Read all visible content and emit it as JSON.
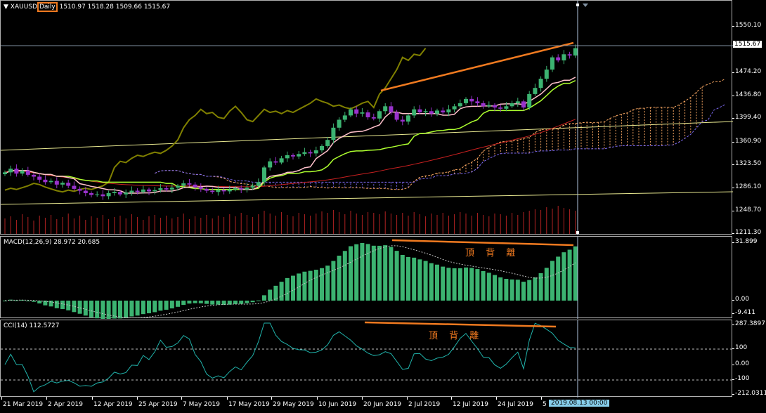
{
  "header": {
    "collapse_icon": "triangle-down-icon",
    "symbol": "XAUUSD",
    "timeframe": "Daily",
    "ohlc": "1510.97 1518.28 1509.66 1515.67"
  },
  "macd_label": "MACD(12,26,9) 28.972 20.685",
  "cci_label": "CCI(14) 112.5727",
  "annotation": "頂 背 離",
  "price_axis": [
    "1550.10",
    "1474.20",
    "1436.80",
    "1399.40",
    "1360.90",
    "1323.50",
    "1286.10",
    "1248.70",
    "1211.30"
  ],
  "current_price": "1515.67",
  "macd_axis": [
    "31.899",
    "0.00",
    "-9.411"
  ],
  "cci_axis": [
    "287.3897",
    "100",
    "0.00",
    "-100",
    "-212.0311"
  ],
  "time_axis": [
    "21 Mar 2019",
    "2 Apr 2019",
    "12 Apr 2019",
    "25 Apr 2019",
    "7 May 2019",
    "17 May 2019",
    "29 May 2019",
    "10 Jun 2019",
    "20 Jun 2019",
    "2 Jul 2019",
    "12 Jul 2019",
    "24 Jul 2019",
    "5"
  ],
  "crosshair_time": "2019.08.13 00:00",
  "colors": {
    "bull": "#3cb371",
    "bear": "#9932cc",
    "tenkan": "#ffc0cb",
    "kijun": "#adff2f",
    "chikou": "#808000",
    "ma": "#c82020",
    "volume": "#b22222",
    "trend": "#f07a20",
    "yellow": "#e8e890",
    "cci": "#20b2aa"
  },
  "chart_data": {
    "type": "candlestick",
    "symbol": "XAUUSD",
    "timeframe": "Daily",
    "ylim": [
      1211.3,
      1550.1
    ],
    "closes": [
      1312,
      1318,
      1310,
      1315,
      1308,
      1305,
      1300,
      1296,
      1298,
      1292,
      1295,
      1290,
      1285,
      1282,
      1278,
      1275,
      1276,
      1273,
      1278,
      1280,
      1276,
      1279,
      1282,
      1280,
      1284,
      1281,
      1283,
      1286,
      1284,
      1287,
      1290,
      1294,
      1292,
      1288,
      1285,
      1282,
      1280,
      1283,
      1281,
      1284,
      1286,
      1284,
      1287,
      1290,
      1296,
      1320,
      1330,
      1328,
      1335,
      1340,
      1338,
      1342,
      1345,
      1343,
      1348,
      1355,
      1365,
      1385,
      1398,
      1405,
      1415,
      1408,
      1410,
      1402,
      1400,
      1412,
      1420,
      1410,
      1398,
      1395,
      1405,
      1415,
      1410,
      1412,
      1408,
      1413,
      1410,
      1415,
      1420,
      1425,
      1432,
      1428,
      1425,
      1420,
      1422,
      1418,
      1416,
      1420,
      1425,
      1428,
      1418,
      1440,
      1450,
      1465,
      1480,
      1500,
      1495,
      1505,
      1503,
      1515
    ],
    "volumes": [
      22,
      25,
      20,
      28,
      24,
      19,
      26,
      23,
      27,
      21,
      24,
      29,
      22,
      26,
      20,
      25,
      23,
      27,
      21,
      24,
      26,
      22,
      28,
      24,
      20,
      25,
      27,
      23,
      26,
      22,
      24,
      29,
      21,
      25,
      23,
      27,
      22,
      26,
      24,
      28,
      25,
      30,
      27,
      24,
      28,
      33,
      29,
      26,
      31,
      27,
      25,
      30,
      28,
      26,
      29,
      32,
      30,
      34,
      31,
      28,
      33,
      29,
      27,
      31,
      30,
      28,
      32,
      29,
      27,
      30,
      26,
      31,
      28,
      25,
      29,
      27,
      30,
      26,
      28,
      31,
      29,
      26,
      30,
      27,
      25,
      29,
      28,
      26,
      30,
      27,
      31,
      33,
      35,
      34,
      38,
      36,
      40,
      37,
      35,
      33
    ],
    "indicators": [
      "Ichimoku",
      "Volumes",
      "MA",
      "MACD(12,26,9)",
      "CCI(14)"
    ]
  }
}
